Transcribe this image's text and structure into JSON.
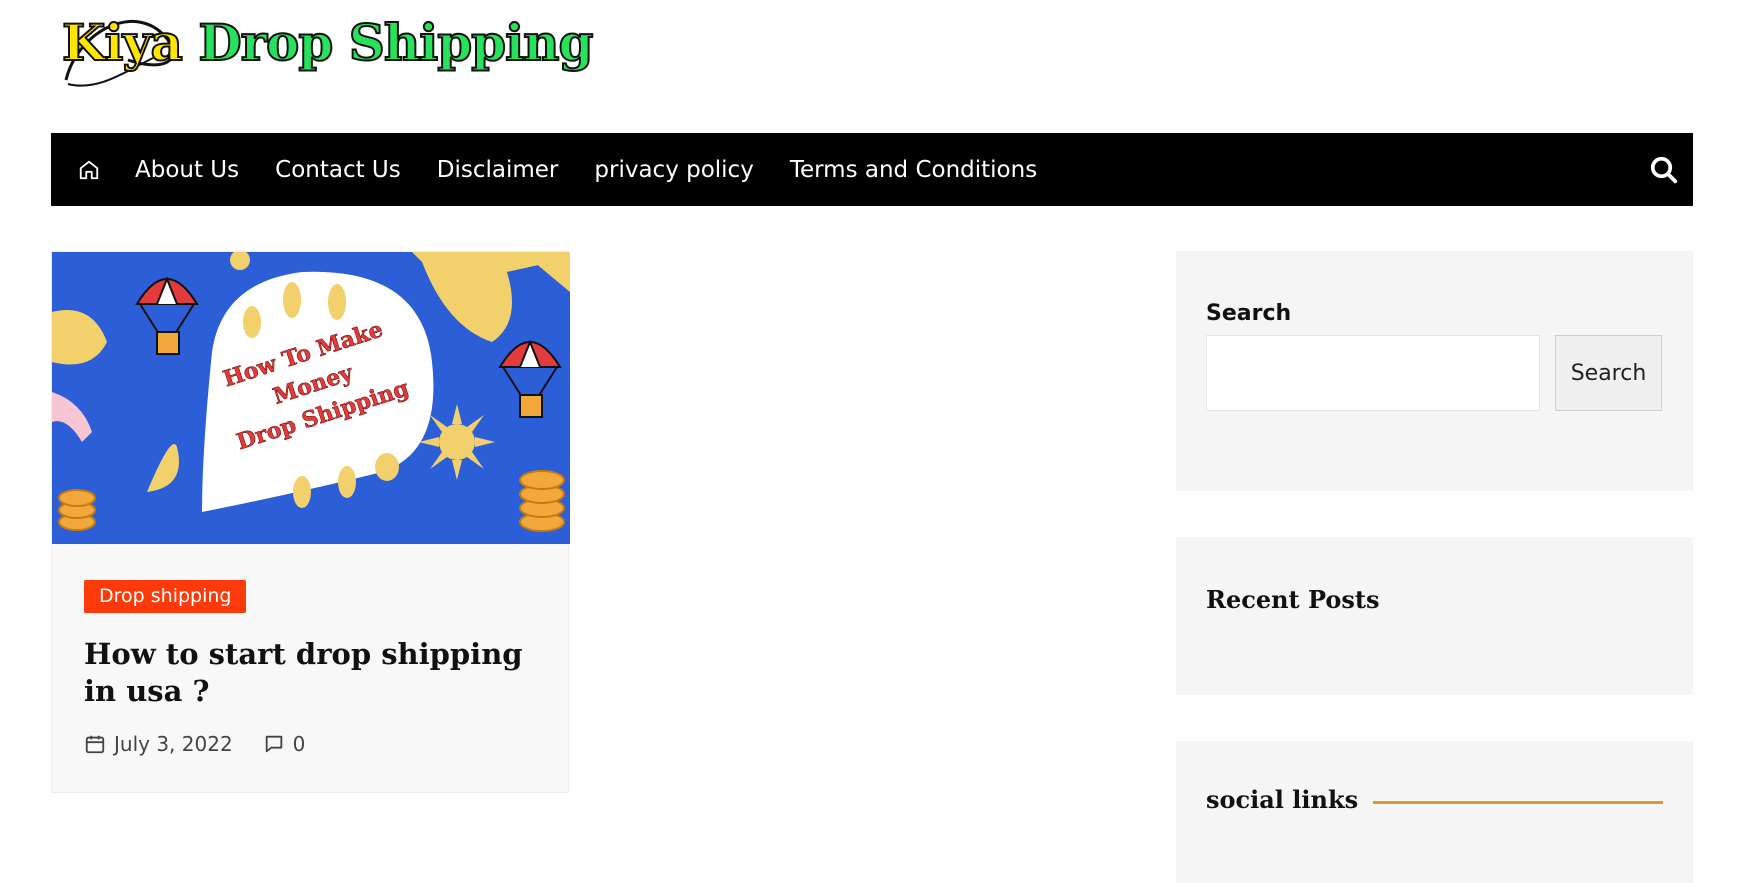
{
  "site": {
    "logo_text_first": "Kiya",
    "logo_text_rest": " Drop Shipping"
  },
  "nav": {
    "home_icon": "home-icon",
    "items": [
      "About Us",
      "Contact Us",
      "Disclaimer",
      "privacy policy",
      "Terms and Conditions"
    ],
    "search_icon": "search-icon"
  },
  "post": {
    "image_text": [
      "How To Make",
      "Money",
      "Drop Shipping"
    ],
    "category": "Drop shipping",
    "title": "How to start drop shipping in usa ?",
    "date": "July 3, 2022",
    "comments": "0"
  },
  "sidebar": {
    "search_label": "Search",
    "search_value": "",
    "search_button": "Search",
    "recent_posts_title": "Recent Posts",
    "social_links_title": "social links"
  },
  "colors": {
    "nav_bg": "#000000",
    "category_badge": "#ff3a0a",
    "logo_yellow": "#ffe600",
    "logo_green": "#26e25c",
    "accent_line": "#d99b2d",
    "widget_bg": "#f5f5f5"
  }
}
